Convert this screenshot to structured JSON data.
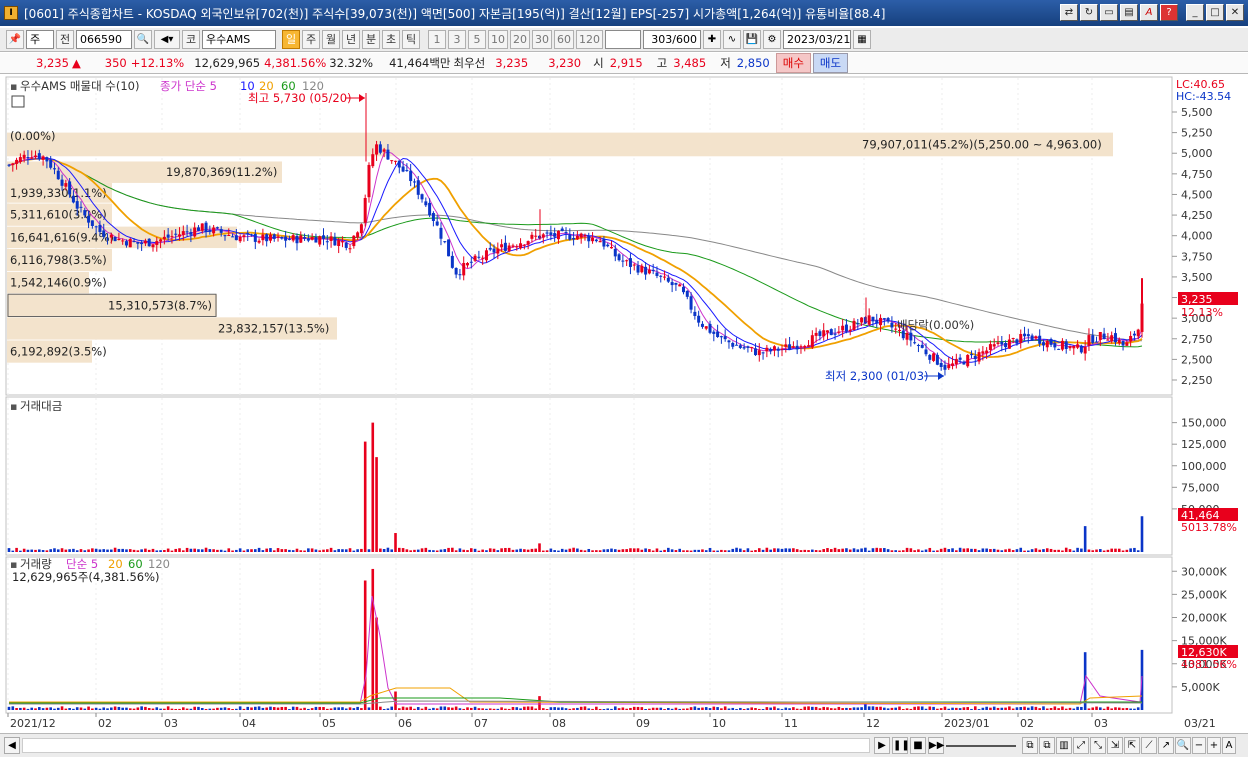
{
  "window": {
    "title": "[0601] 주식종합차트 - KOSDAQ 외국인보유[702(천)] 주식수[39,073(천)] 액면[500] 자본금[195(억)] 결산[12월] EPS[-257] 시가총액[1,264(억)] 유통비율[88.4]",
    "icon_label": "I"
  },
  "toolbar": {
    "market_type": "주",
    "prev_label": "전",
    "code": "066590",
    "market_badge": "코",
    "stock_name": "우수AMS",
    "periods": [
      "일",
      "주",
      "월",
      "년",
      "분",
      "초",
      "틱"
    ],
    "active_period": "일",
    "intervals": [
      "1",
      "3",
      "5",
      "10",
      "20",
      "30",
      "60",
      "120"
    ],
    "count": "303",
    "count_total": "/600",
    "date": "2023/03/21"
  },
  "quote": {
    "price": "3,235",
    "change": "350",
    "change_pct": "+12.13%",
    "volume": "12,629,965",
    "volume_pct": "4,381.56%",
    "turnover": "32.32%",
    "amount": "41,464백만",
    "bid_label": "최우선",
    "bid": "3,235",
    "ask": "3,230",
    "open_label": "시",
    "open": "2,915",
    "high_label": "고",
    "high": "3,485",
    "low_label": "저",
    "low": "2,850",
    "buy_label": "매수",
    "sell_label": "매도"
  },
  "price_panel": {
    "legend_title": "우수AMS 매물대 수(10)",
    "ma_legend": "종가 단순 5",
    "ma_periods": [
      "10",
      "20",
      "60",
      "120"
    ],
    "max_label": "최고 5,730 (05/20)",
    "min_label": "최저 2,300 (01/03)",
    "dividend_label": "배당락(0.00%)",
    "zero_label": "(0.00%)",
    "lc": "LC:40.65",
    "hc": "HC:-43.54",
    "current_tag": "3,235",
    "current_pct": "12.13%",
    "y_ticks": [
      "5,500",
      "5,250",
      "5,000",
      "4,750",
      "4,500",
      "4,250",
      "4,000",
      "3,750",
      "3,500",
      "3,250",
      "3,000",
      "2,750",
      "2,500",
      "2,250"
    ],
    "volume_profile": [
      "79,907,011(45.2%)(5,250.00 ~ 4,963.00)",
      "19,870,369(11.2%)",
      "1,939,330(1.1%)",
      "5,311,610(3.0%)",
      "16,641,616(9.4%)",
      "6,116,798(3.5%)",
      "1,542,146(0.9%)",
      "15,310,573(8.7%)",
      "23,832,157(13.5%)",
      "6,192,892(3.5%)"
    ]
  },
  "amount_panel": {
    "title": "거래대금",
    "y_ticks": [
      "150,000",
      "125,000",
      "100,000",
      "75,000",
      "50,000"
    ],
    "current_tag": "41,464",
    "current_pct": "5013.78%"
  },
  "volume_panel": {
    "title": "거래량",
    "ma_legend": "단순 5",
    "ma_periods": [
      "20",
      "60",
      "120"
    ],
    "summary": "12,629,965주(4,381.56%)",
    "y_ticks": [
      "30,000K",
      "25,000K",
      "20,000K",
      "15,000K",
      "10,000K",
      "5,000K"
    ],
    "current_tag": "12,630K",
    "current_pct": "4381.56%"
  },
  "x_axis": {
    "labels": [
      "2021/12",
      "02",
      "03",
      "04",
      "05",
      "06",
      "07",
      "08",
      "09",
      "10",
      "11",
      "12",
      "2023/01",
      "02",
      "03"
    ],
    "right_label": "03/21"
  },
  "colors": {
    "up": "#e8001c",
    "down": "#0a35c8",
    "ma5": "#cc33cc",
    "ma10": "#1a1aff",
    "ma20": "#f0a000",
    "ma60": "#1a9a1a",
    "ma120": "#888888",
    "profile": "#f3e3cc"
  }
}
